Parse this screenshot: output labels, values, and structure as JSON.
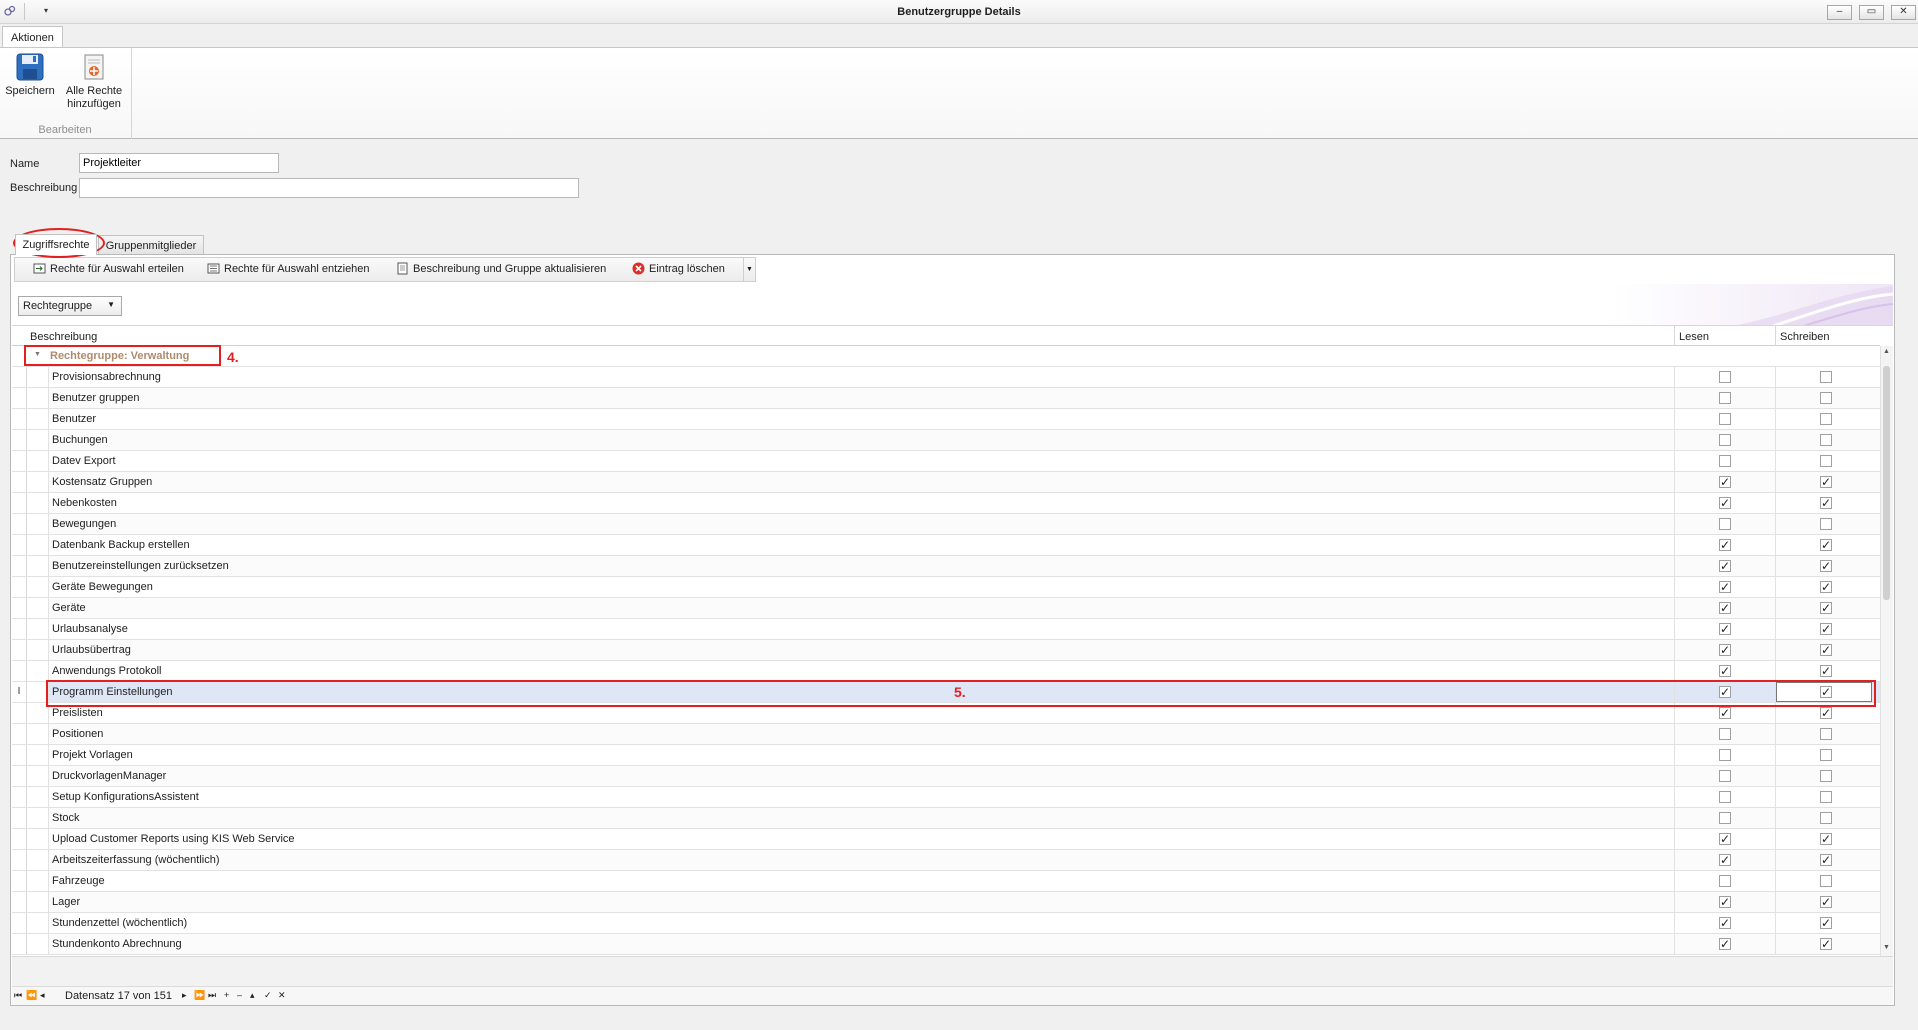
{
  "window": {
    "title": "Benutzergruppe Details",
    "qa_arrow": "▾",
    "controls": [
      "–",
      "▭",
      "✕"
    ]
  },
  "ribbon": {
    "tab": "Aktionen",
    "buttons": {
      "save": "Speichern",
      "add_all_1": "Alle Rechte",
      "add_all_2": "hinzufügen"
    },
    "group_label": "Bearbeiten"
  },
  "form": {
    "name_label": "Name",
    "name_value": "Projektleiter",
    "desc_label": "Beschreibung",
    "desc_value": ""
  },
  "tabs": {
    "rights": "Zugriffsrechte",
    "members": "Gruppenmitglieder"
  },
  "toolbar": {
    "grant": "Rechte für Auswahl erteilen",
    "revoke": "Rechte für Auswahl entziehen",
    "update": "Beschreibung und Gruppe aktualisieren",
    "delete": "Eintrag löschen"
  },
  "groupby": {
    "label": "Rechtegruppe"
  },
  "grid": {
    "columns": {
      "description": "Beschreibung",
      "read": "Lesen",
      "write": "Schreiben"
    },
    "group_row": "Rechtegruppe: Verwaltung",
    "focused_indicator": "I",
    "rows": [
      {
        "name": "Provisionsabrechnung",
        "read": false,
        "write": false
      },
      {
        "name": "Benutzer gruppen",
        "read": false,
        "write": false
      },
      {
        "name": "Benutzer",
        "read": false,
        "write": false
      },
      {
        "name": "Buchungen",
        "read": false,
        "write": false
      },
      {
        "name": "Datev Export",
        "read": false,
        "write": false
      },
      {
        "name": "Kostensatz Gruppen",
        "read": true,
        "write": true
      },
      {
        "name": "Nebenkosten",
        "read": true,
        "write": true
      },
      {
        "name": "Bewegungen",
        "read": false,
        "write": false
      },
      {
        "name": "Datenbank Backup erstellen",
        "read": true,
        "write": true
      },
      {
        "name": "Benutzereinstellungen zurücksetzen",
        "read": true,
        "write": true
      },
      {
        "name": "Geräte Bewegungen",
        "read": true,
        "write": true
      },
      {
        "name": "Geräte",
        "read": true,
        "write": true
      },
      {
        "name": "Urlaubsanalyse",
        "read": true,
        "write": true
      },
      {
        "name": "Urlaubsübertrag",
        "read": true,
        "write": true
      },
      {
        "name": "Anwendungs Protokoll",
        "read": true,
        "write": true
      },
      {
        "name": "Programm Einstellungen",
        "read": true,
        "write": true,
        "focused": true
      },
      {
        "name": "Preislisten",
        "read": true,
        "write": true
      },
      {
        "name": "Positionen",
        "read": false,
        "write": false
      },
      {
        "name": "Projekt Vorlagen",
        "read": false,
        "write": false
      },
      {
        "name": "DruckvorlagenManager",
        "read": false,
        "write": false
      },
      {
        "name": "Setup KonfigurationsAssistent",
        "read": false,
        "write": false
      },
      {
        "name": "Stock",
        "read": false,
        "write": false
      },
      {
        "name": "Upload Customer Reports using KIS Web Service",
        "read": true,
        "write": true
      },
      {
        "name": "Arbeitszeiterfassung (wöchentlich)",
        "read": true,
        "write": true
      },
      {
        "name": "Fahrzeuge",
        "read": false,
        "write": false
      },
      {
        "name": "Lager",
        "read": true,
        "write": true
      },
      {
        "name": "Stundenzettel (wöchentlich)",
        "read": true,
        "write": true
      },
      {
        "name": "Stundenkonto Abrechnung",
        "read": true,
        "write": true
      }
    ]
  },
  "navigator": {
    "buttons": [
      "⏮",
      "⏪",
      "◂",
      "▸",
      "⏩",
      "⏭",
      "+",
      "–",
      "▴",
      "✓",
      "✕"
    ],
    "record_text": "Datensatz 17 von 151"
  },
  "annotations": {
    "step4": "4.",
    "step5": "5."
  },
  "colors": {
    "annotation": "#e41f1f",
    "group_text": "#b08a6b",
    "focused_row": "#dfe7f7"
  }
}
